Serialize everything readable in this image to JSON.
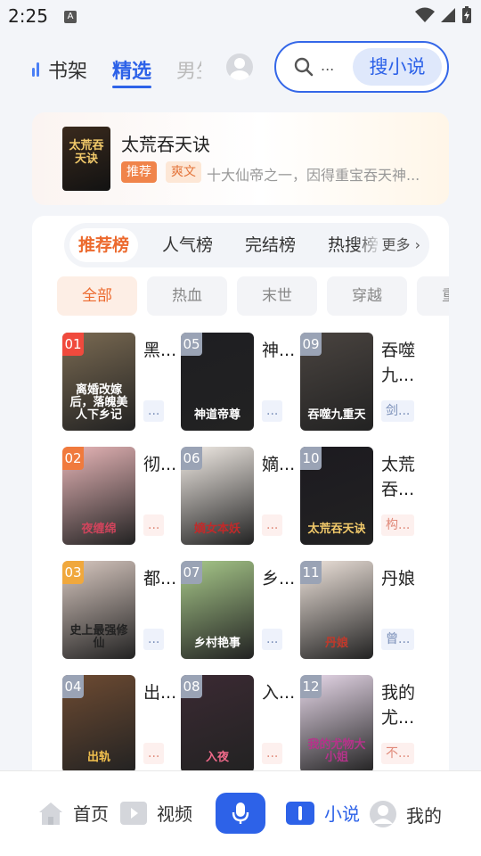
{
  "status": {
    "time": "2:25"
  },
  "topnav": {
    "tabs": [
      "书架",
      "精选",
      "男生"
    ],
    "active_tab": "精选",
    "search_placeholder": "...",
    "search_button": "搜小说"
  },
  "featured": {
    "title": "太荒吞天诀",
    "tags": [
      "推荐",
      "爽文"
    ],
    "description": "十大仙帝之一，因得重宝吞天神..."
  },
  "rank": {
    "tabs": [
      "推荐榜",
      "人气榜",
      "完结榜",
      "热搜榜"
    ],
    "active": "推荐榜",
    "more": "更多",
    "chips": [
      "全部",
      "热血",
      "末世",
      "穿越",
      "重生"
    ],
    "active_chip": "全部",
    "books": [
      {
        "rank": "01",
        "name": "黑...",
        "tag": "...",
        "cover_title": "离婚改嫁后，落魄美人下乡记",
        "rank_color": "#f04a3d",
        "bg": "#7a6a52",
        "title_color": "#ffffff"
      },
      {
        "rank": "02",
        "name": "彻...",
        "tag": "...",
        "cover_title": "夜缠绵",
        "rank_color": "#f07a3d",
        "bg": "#e8b6b8",
        "title_color": "#d0445c"
      },
      {
        "rank": "03",
        "name": "都...",
        "tag": "...",
        "cover_title": "史上最强修仙",
        "rank_color": "#f0a83d",
        "bg": "#d8c8c0",
        "title_color": "#222222"
      },
      {
        "rank": "04",
        "name": "出...",
        "tag": "...",
        "cover_title": "出轨",
        "rank_color": "#9aa3b5",
        "bg": "#6e4b32",
        "title_color": "#f2c14e"
      },
      {
        "rank": "05",
        "name": "神...",
        "tag": "...",
        "cover_title": "神道帝尊",
        "rank_color": "#9aa3b5",
        "bg": "#1e1e22",
        "title_color": "#ffffff"
      },
      {
        "rank": "06",
        "name": "嫡...",
        "tag": "...",
        "cover_title": "嫡女本妖",
        "rank_color": "#9aa3b5",
        "bg": "#f2ece6",
        "title_color": "#c02a2a"
      },
      {
        "rank": "07",
        "name": "乡...",
        "tag": "...",
        "cover_title": "乡村艳事",
        "rank_color": "#9aa3b5",
        "bg": "#a8c98a",
        "title_color": "#ffffff"
      },
      {
        "rank": "08",
        "name": "入...",
        "tag": "...",
        "cover_title": "入夜",
        "rank_color": "#9aa3b5",
        "bg": "#3b2a33",
        "title_color": "#f06a8a"
      },
      {
        "rank": "09",
        "name": "吞噬九...",
        "tag": "剑...",
        "cover_title": "吞噬九重天",
        "rank_color": "#9aa3b5",
        "bg": "#4a4440",
        "title_color": "#ffffff"
      },
      {
        "rank": "10",
        "name": "太荒吞...",
        "tag": "构...",
        "cover_title": "太荒吞天诀",
        "rank_color": "#9aa3b5",
        "bg": "#1c1a20",
        "title_color": "#f1c96a"
      },
      {
        "rank": "11",
        "name": "丹娘",
        "tag": "曾...",
        "cover_title": "丹娘",
        "rank_color": "#9aa3b5",
        "bg": "#efe4dc",
        "title_color": "#c0392b"
      },
      {
        "rank": "12",
        "name": "我的尤...",
        "tag": "不...",
        "cover_title": "我的尤物大小姐",
        "rank_color": "#9aa3b5",
        "bg": "#e8d9ea",
        "title_color": "#b5338a"
      }
    ]
  },
  "bottomnav": {
    "items": [
      "首页",
      "视频",
      "小说",
      "我的"
    ],
    "active": "小说"
  }
}
